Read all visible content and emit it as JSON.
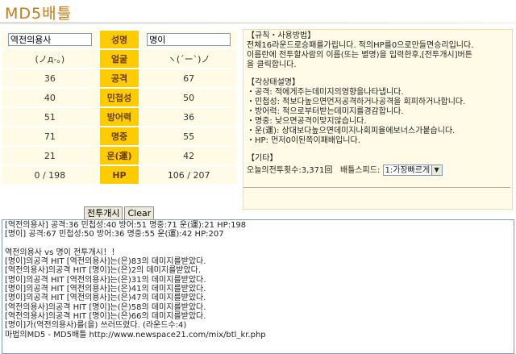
{
  "header": {
    "title": "MD5배틀"
  },
  "stats": {
    "labels": {
      "name": "성명",
      "face": "얼굴",
      "attack": "공격",
      "agility": "민첩성",
      "defense": "방어력",
      "accuracy": "명중",
      "luck": "운(運)",
      "hp": "HP"
    },
    "left": {
      "name": "역전의용사",
      "face": "(ノд-｡)",
      "attack": "36",
      "agility": "40",
      "defense": "51",
      "accuracy": "71",
      "luck": "21",
      "hp": "0 / 198"
    },
    "right": {
      "name": "명이",
      "face": "ヽ(´ー`)ノ",
      "attack": "67",
      "agility": "50",
      "defense": "36",
      "accuracy": "55",
      "luck": "42",
      "hp": "106 / 207"
    }
  },
  "buttons": {
    "start": "전투개시",
    "clear": "Clear"
  },
  "rules": {
    "section1_title": "【규칙・사용방법】",
    "section1_lines": [
      "전체16라운드로승패를가립니다. 적의HP를0으로만들면승리입니다.",
      "이름란에 전투할사람의 이름(또는 별명)을 입력한후,[전투개시]버튼",
      "을 클릭합니다."
    ],
    "section2_title": "【각상태설명】",
    "section2_lines": [
      "・공격: 적에게주는데미지의영향을나타냅니다.",
      "・민첩성: 적보다높으면먼저공격하거나공격을 회피하거나합니다.",
      "・방어력: 적으로부터받는데미지를경감합니다.",
      "・명중: 낮으면공격이맞지않습니다.",
      "・운(運): 상대보다높으면데미지나회피율에보너스가붙습니다.",
      "・HP: 먼저0이된쪽이패배입니다."
    ],
    "section3_title": "【기타】",
    "battle_count": "오늘의전투횟수:3,371回",
    "speed_label": "배틀스피드:",
    "speed_value": "1:가장빠르게"
  },
  "log": {
    "lines": [
      "[역전의용사] 공격:36 민첩성:40 방어:51 명중:71 운(運):21 HP:198",
      "[명이] 공격:67 민첩성:50 방어:36 명중:55 운(運):42 HP:207",
      "",
      "역전의용사 vs 명이 전투개시！！",
      "[명이]의공격 HIT [역전의용사]는(은)83의 데미지를받았다.",
      "[역전의용사]의공격 HIT [명이]는(은)2의 데미지를받았다.",
      "[명이]의공격 HIT [역전의용사]는(은)31의 데미지를받았다.",
      "[명이]의공격 HIT [역전의용사]는(은)41의 데미지를받았다.",
      "[명이]의공격 HIT [역전의용사]는(은)47의 데미지를받았다.",
      "[역전의용사]의공격 HIT [명이]는(은)58의 데미지를받았다.",
      "[역전의용사]의공격 HIT [명이]는(은)66의 데미지를받았다.",
      "[명이]가(역전의용사)를(을) 쓰러뜨렸다. (라운드수:4)",
      "마법의MD5 - MD5배틀 http://www.newspace21.com/mix/btl_kr.php"
    ]
  }
}
